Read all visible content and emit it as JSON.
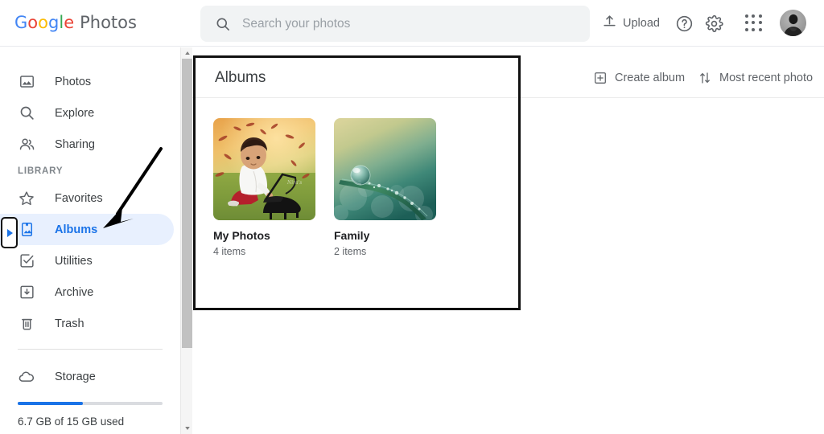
{
  "app": {
    "brand_google": [
      "G",
      "o",
      "o",
      "g",
      "l",
      "e"
    ],
    "brand_product": "Photos"
  },
  "search": {
    "placeholder": "Search your photos",
    "value": "",
    "icon": "search-icon"
  },
  "toolbar": {
    "upload_label": "Upload",
    "upload_icon": "upload-icon",
    "help_icon": "help-circle-icon",
    "settings_icon": "gear-icon",
    "apps_icon": "apps-grid-icon",
    "avatar_icon": "user-avatar"
  },
  "sidebar": {
    "items": [
      {
        "label": "Photos",
        "icon": "photo-icon",
        "active": false
      },
      {
        "label": "Explore",
        "icon": "search-icon",
        "active": false
      },
      {
        "label": "Sharing",
        "icon": "people-icon",
        "active": false
      }
    ],
    "library_label": "LIBRARY",
    "library_items": [
      {
        "label": "Favorites",
        "icon": "star-icon",
        "active": false
      },
      {
        "label": "Albums",
        "icon": "album-icon",
        "active": true
      },
      {
        "label": "Utilities",
        "icon": "check-box-icon",
        "active": false
      },
      {
        "label": "Archive",
        "icon": "archive-icon",
        "active": false
      },
      {
        "label": "Trash",
        "icon": "trash-icon",
        "active": false
      }
    ],
    "storage": {
      "label": "Storage",
      "icon": "cloud-icon",
      "used_text": "6.7 GB of 15 GB used",
      "percent": 45,
      "fill_color": "#1a73e8",
      "track_color": "#dadce0"
    }
  },
  "scrollbar": {
    "up_arrow": "scroll-up-arrow",
    "down_arrow": "scroll-down-arrow"
  },
  "main": {
    "title": "Albums",
    "actions": [
      {
        "label": "Create album",
        "icon": "plus-box-icon"
      },
      {
        "label": "Most recent photo",
        "icon": "sort-arrows-icon"
      }
    ],
    "albums": [
      {
        "name": "My Photos",
        "count": "4 items",
        "thumb": "child-with-toy-piano-autumn"
      },
      {
        "name": "Family",
        "count": "2 items",
        "thumb": "dewdrop-on-green-grass-blade"
      }
    ]
  },
  "annotations": {
    "content_highlight_box": "black-rectangle-around-albums-panel",
    "sidebar_marker_box": "black-rounded-box-with-blue-triangle",
    "arrow": "black-arrow-pointing-to-albums"
  },
  "colors": {
    "accent_blue": "#1a73e8",
    "active_pill": "#e8f0fe",
    "text_primary": "#3c4043",
    "text_secondary": "#5f6368",
    "search_bg": "#f1f3f4"
  }
}
